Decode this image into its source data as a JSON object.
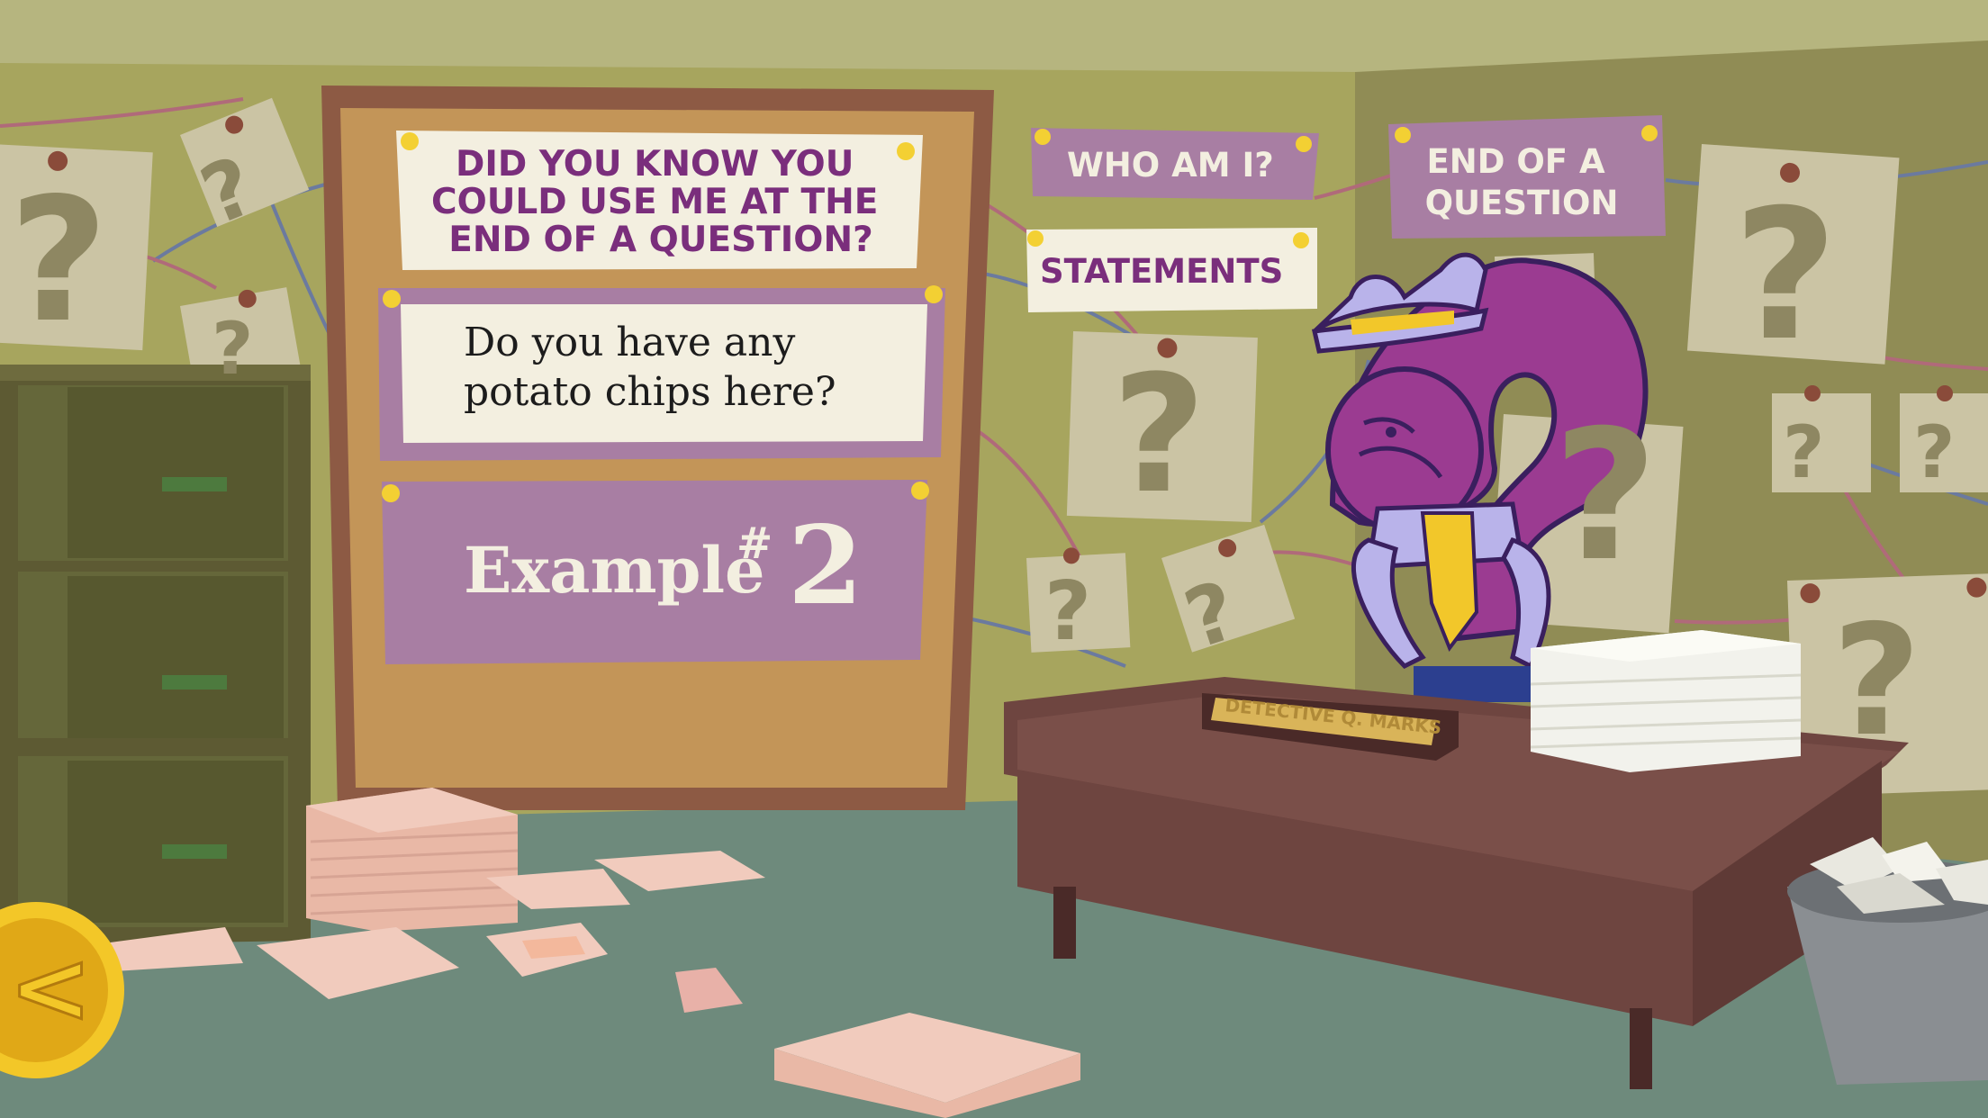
{
  "board": {
    "question_card": "DID YOU KNOW YOU COULD USE ME AT THE END OF A QUESTION?",
    "question_lines": [
      "DID YOU KNOW YOU",
      "COULD USE ME AT THE",
      "END OF A QUESTION?"
    ],
    "sentence_lines": [
      "Do you have any",
      "potato chips here?"
    ],
    "example_label": "Example",
    "example_symbol": "#",
    "example_number": "2"
  },
  "wall_cards": {
    "who_am_i": "WHO AM I?",
    "statements": "STATEMENTS",
    "end_of_question_lines": [
      "END OF A",
      "QUESTION"
    ]
  },
  "desk": {
    "nameplate": "DETECTIVE Q. MARKS"
  },
  "wall_mark_glyph": "?",
  "controls": {
    "back_button_glyph": "<",
    "back_button_icon": "back-arrow-icon"
  },
  "colors": {
    "wall": "#a7a55e",
    "ceiling": "#b6b57f",
    "floor": "#6e8a7c",
    "purple_card": "#a87ea3",
    "purple_text": "#7a2e7c",
    "character": "#9b3b91",
    "corkboard": "#c39558",
    "desk": "#6e4540",
    "gold": "#f3c728"
  }
}
